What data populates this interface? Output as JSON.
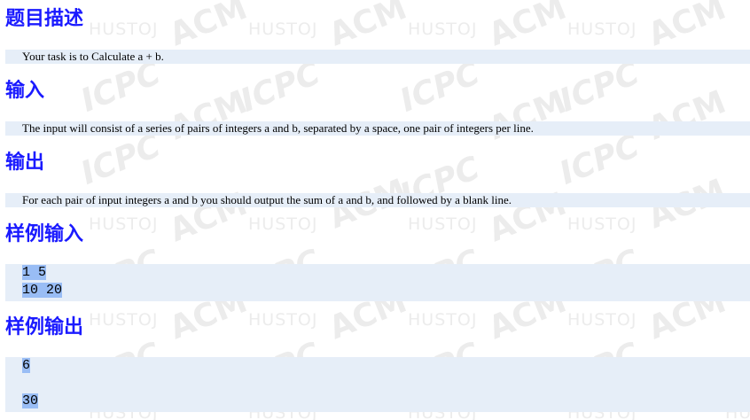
{
  "watermark": {
    "texts": [
      "HUSTOJ",
      "ACM",
      "ICPC"
    ]
  },
  "sections": {
    "description": {
      "title": "题目描述",
      "text": "Your task is to Calculate a + b."
    },
    "input": {
      "title": "输入",
      "text": "The input will consist of a series of pairs of integers a and b, separated by a space, one pair of integers per line."
    },
    "output": {
      "title": "输出",
      "text": "For each pair of input integers a and b you should output the sum of a and b, and followed by a blank line."
    },
    "sample_input": {
      "title": "样例输入",
      "lines": [
        "1 5",
        "10 20"
      ]
    },
    "sample_output": {
      "title": "样例输出",
      "lines": [
        "6",
        "",
        "30"
      ]
    }
  },
  "colors": {
    "heading": "#1a1aff",
    "box_background": "#e6eef8",
    "selection_highlight": "#99bdf5"
  }
}
